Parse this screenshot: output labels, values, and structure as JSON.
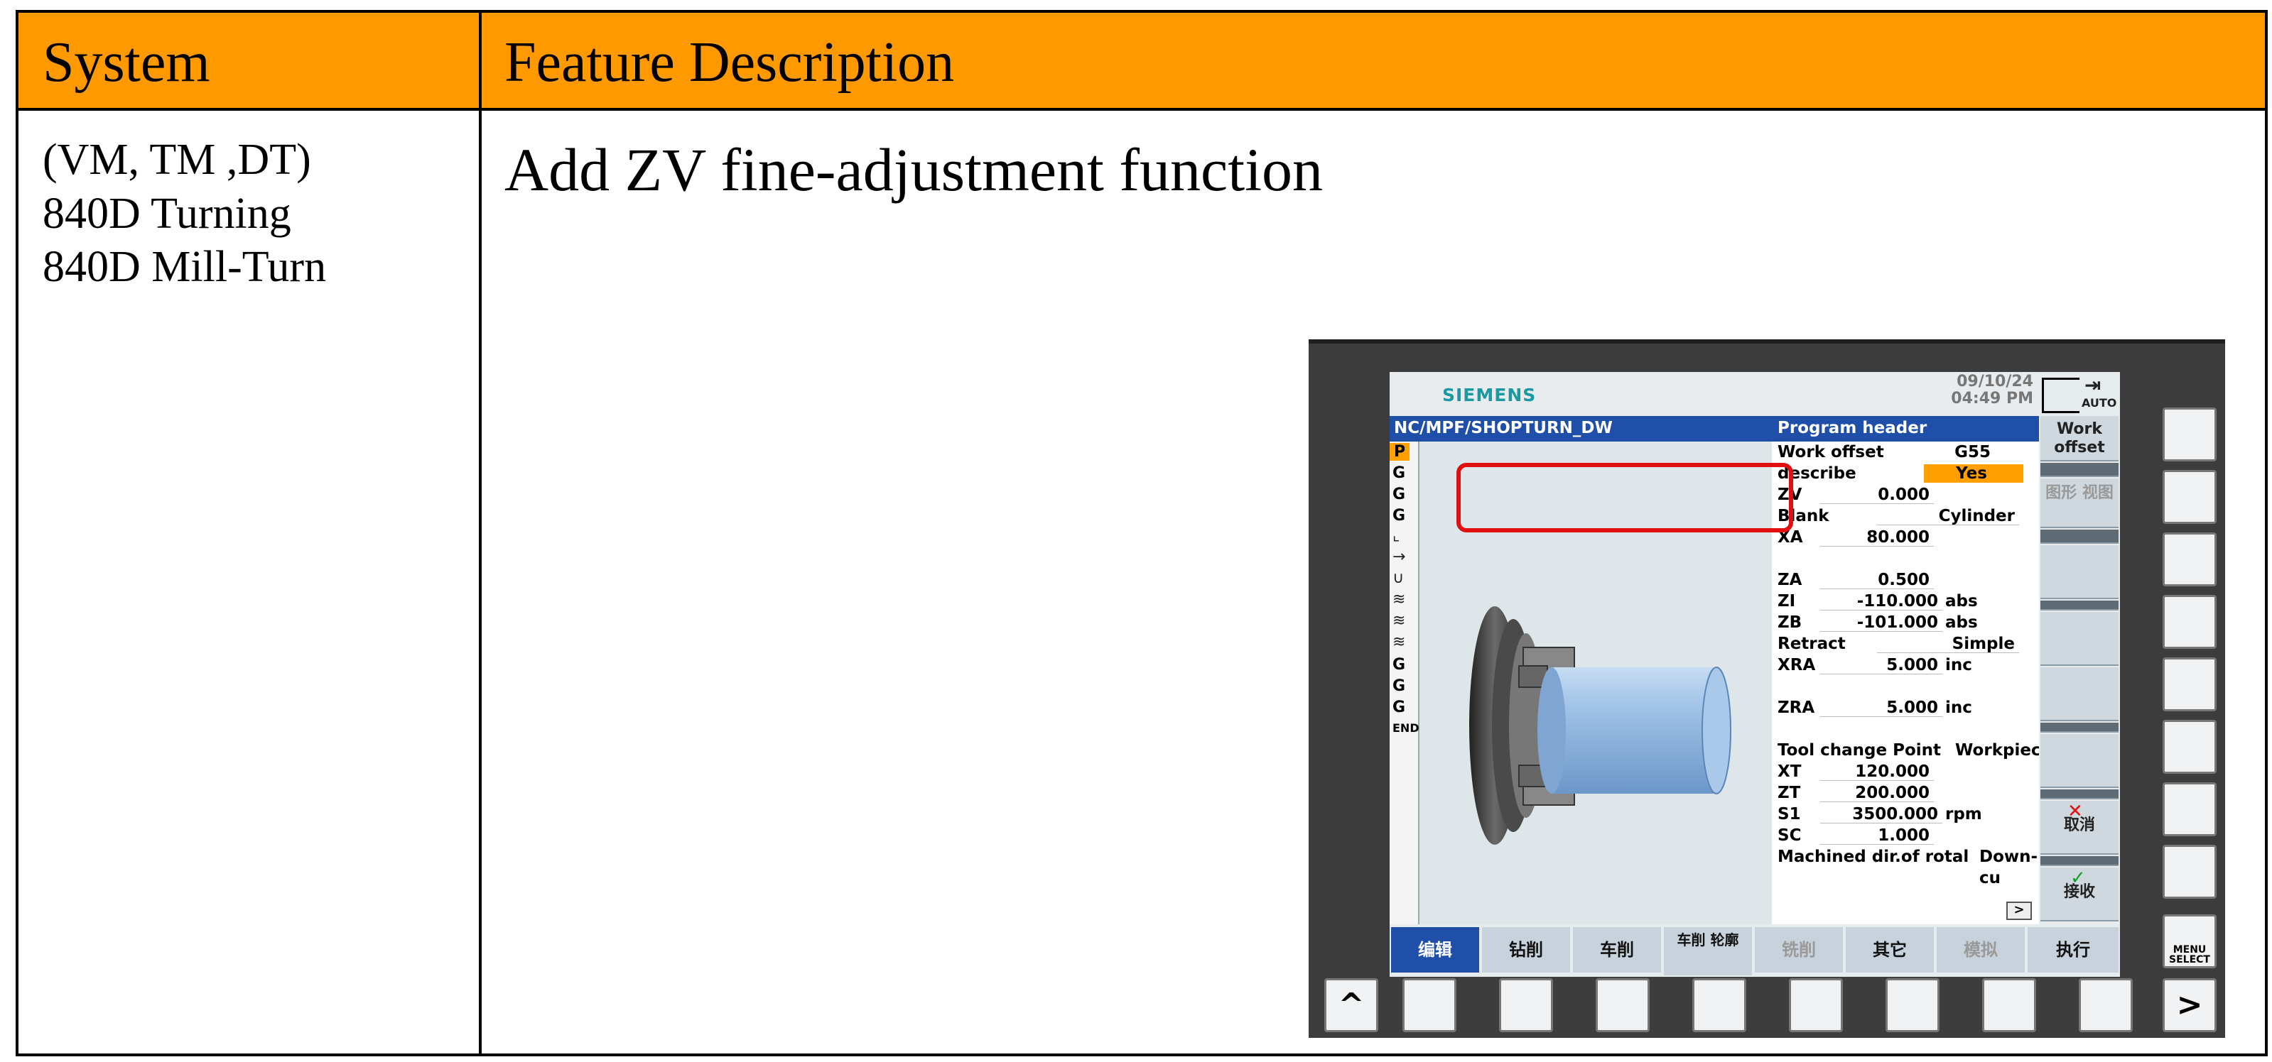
{
  "table": {
    "headers": [
      "System",
      "Feature Description"
    ],
    "system_lines": [
      "(VM, TM ,DT)",
      "840D Turning",
      "840D Mill-Turn"
    ],
    "feature": "Add ZV fine-adjustment function"
  },
  "hmi": {
    "brand": "SIEMENS",
    "date": "09/10/24",
    "time": "04:49 PM",
    "path": "NC/MPF/SHOPTURN_DW",
    "form_title": "Program header",
    "program_list": [
      "P",
      "G",
      "G",
      "G",
      "G",
      "G",
      "G",
      "END"
    ],
    "fields": {
      "work_offset": {
        "label": "Work offset",
        "value": "G55"
      },
      "describe": {
        "label": "describe",
        "value": "Yes"
      },
      "zv": {
        "label": "ZV",
        "value": "0.000"
      },
      "blank": {
        "label": "Blank",
        "value": "Cylinder"
      },
      "xa": {
        "label": "XA",
        "value": "80.000"
      },
      "za": {
        "label": "ZA",
        "value": "0.500"
      },
      "zi": {
        "label": "ZI",
        "value": "-110.000",
        "unit": "abs"
      },
      "zb": {
        "label": "ZB",
        "value": "-101.000",
        "unit": "abs"
      },
      "retract": {
        "label": "Retract",
        "value": "Simple"
      },
      "xra": {
        "label": "XRA",
        "value": "5.000",
        "unit": "inc"
      },
      "zra": {
        "label": "ZRA",
        "value": "5.000",
        "unit": "inc"
      },
      "tool_change": {
        "label": "Tool change Point",
        "value": "Workpiece"
      },
      "xt": {
        "label": "XT",
        "value": "120.000"
      },
      "zt": {
        "label": "ZT",
        "value": "200.000"
      },
      "s1": {
        "label": "S1",
        "value": "3500.000",
        "unit": "rpm"
      },
      "sc": {
        "label": "SC",
        "value": "1.000"
      },
      "machined_dir": {
        "label": "Machined dir.of rotal",
        "value": "Down-cu"
      }
    },
    "vertical_softkeys": {
      "work_offset": "Work offset",
      "graphic_view": "图形 视图",
      "cancel": "取消",
      "accept": "接收",
      "auto": "AUTO"
    },
    "horizontal_softkeys": [
      "编辑",
      "钻削",
      "车削",
      "车削 轮廓",
      "铣削",
      "其它",
      "模拟",
      "执行"
    ],
    "bottom_keys": {
      "up": "^",
      "next": ">"
    },
    "menu_select": "MENU SELECT",
    "more": ">"
  }
}
